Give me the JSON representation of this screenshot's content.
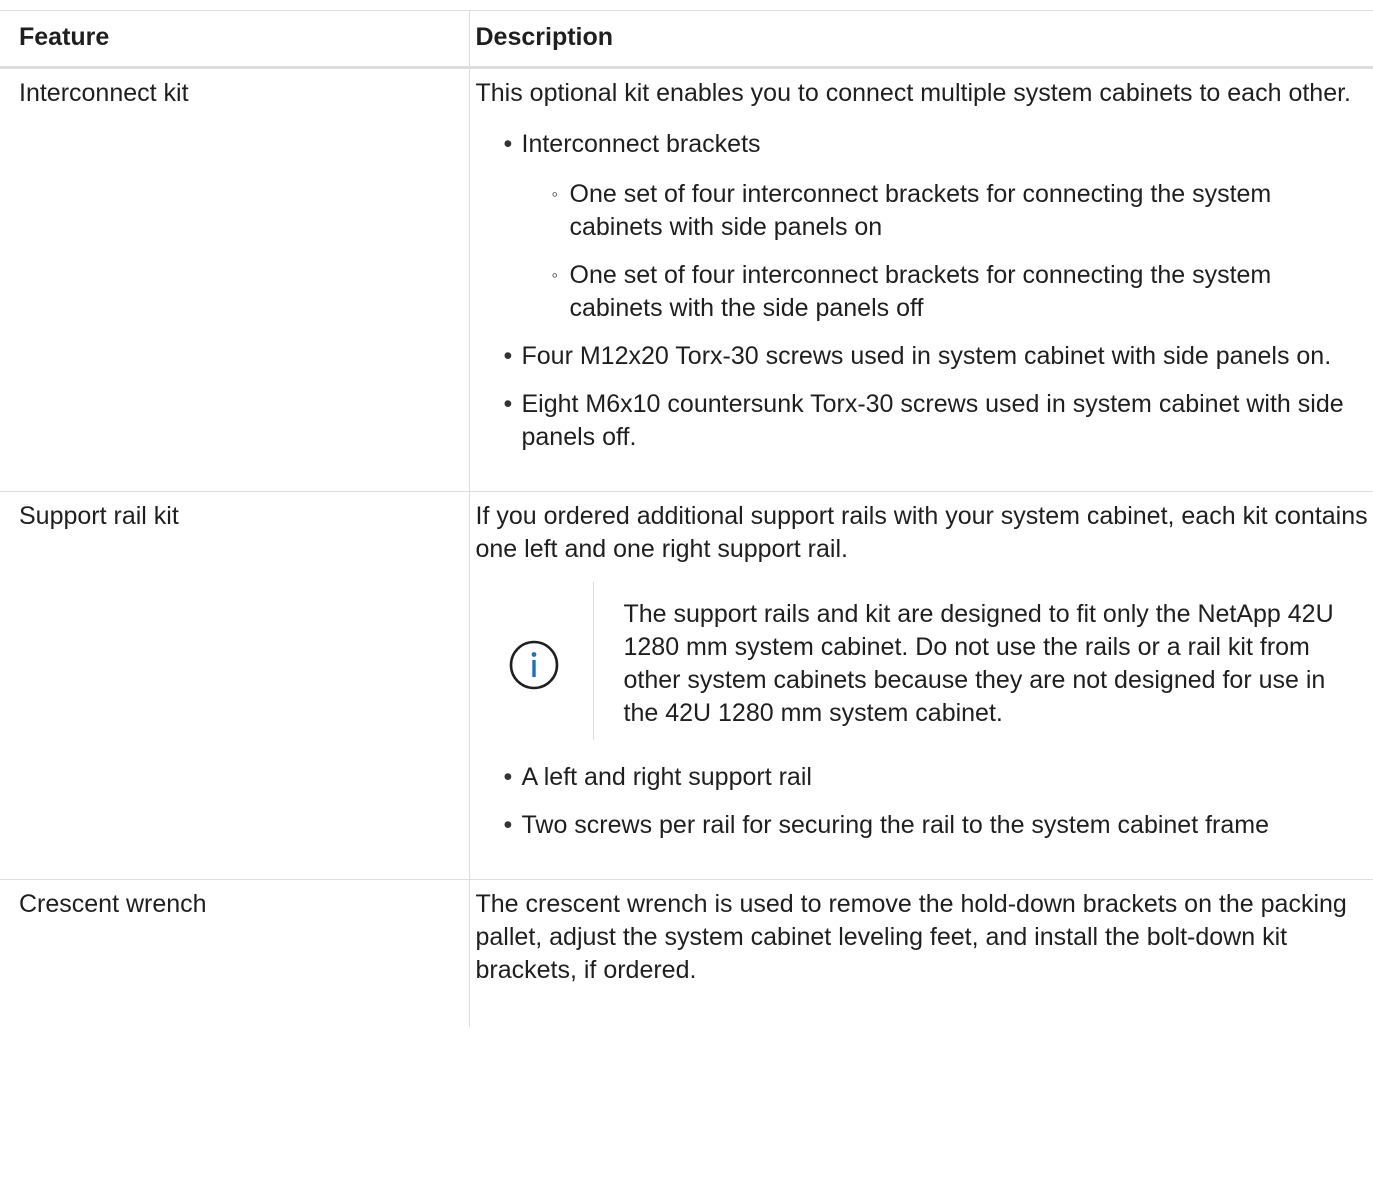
{
  "table": {
    "headers": {
      "feature": "Feature",
      "description": "Description"
    },
    "rows": [
      {
        "feature": "Interconnect kit",
        "intro": "This optional kit enables you to connect multiple system cabinets to each other.",
        "bullets": [
          {
            "text": "Interconnect brackets",
            "sub": [
              "One set of four interconnect brackets for connecting the system cabinets with side panels on",
              "One set of four interconnect brackets for connecting the system cabinets with the side panels off"
            ]
          },
          {
            "text": "Four M12x20 Torx-30 screws used in system cabinet with side panels on."
          },
          {
            "text": "Eight M6x10 countersunk Torx-30 screws used in system cabinet with side panels off."
          }
        ]
      },
      {
        "feature": "Support rail kit",
        "intro": "If you ordered additional support rails with your system cabinet, each kit contains one left and one right support rail.",
        "note": "The support rails and kit are designed to fit only the NetApp 42U 1280 mm system cabinet. Do not use the rails or a rail kit from other system cabinets because they are not designed for use in the 42U 1280 mm system cabinet.",
        "note_icon": "info-icon",
        "bullets": [
          {
            "text": "A left and right support rail"
          },
          {
            "text": "Two screws per rail for securing the rail to the system cabinet frame"
          }
        ]
      },
      {
        "feature": "Crescent wrench",
        "intro": "The crescent wrench is used to remove the hold-down brackets on the packing pallet, adjust the system cabinet leveling feet, and install the bolt-down kit brackets, if ordered."
      }
    ]
  },
  "colors": {
    "text": "#1f1f1f",
    "border": "#dddddd",
    "icon": "#1a73b8"
  }
}
